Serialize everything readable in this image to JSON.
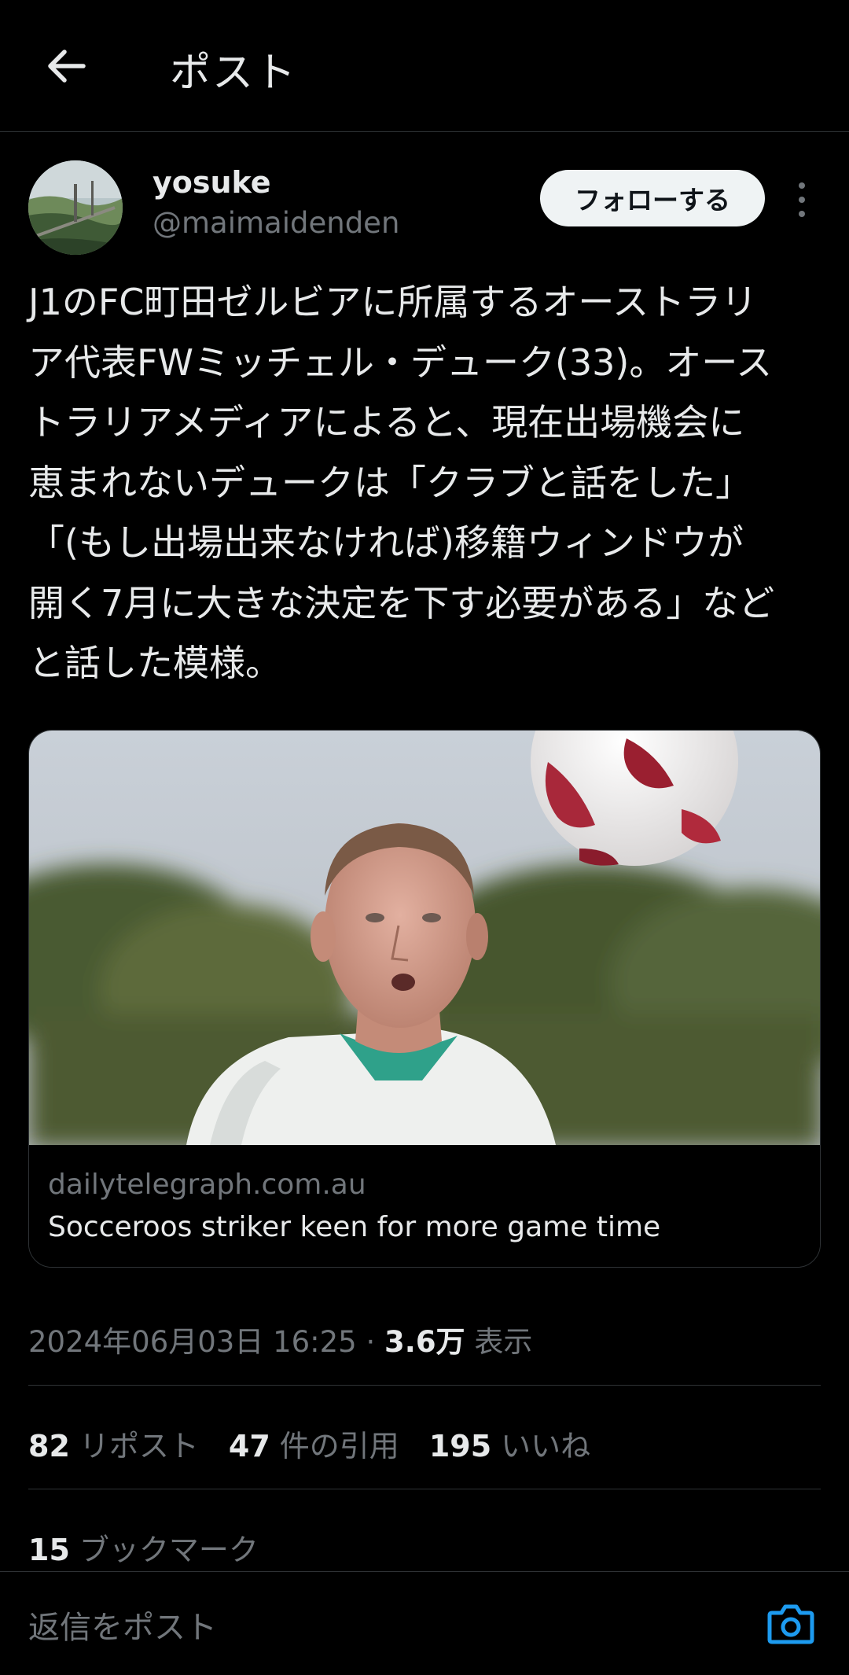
{
  "header": {
    "title": "ポスト"
  },
  "author": {
    "name": "yosuke",
    "handle": "@maimaidenden"
  },
  "actions": {
    "follow_label": "フォローする"
  },
  "post": {
    "text": "J1のFC町田ゼルビアに所属するオーストラリ\nア代表FWミッチェル・デューク(33)。オース\nトラリアメディアによると、現在出場機会に\n恵まれないデュークは「クラブと話をした」\n「(もし出場出来なければ)移籍ウィンドウが\n開く7月に大きな決定を下す必要がある」など\nと話した模様。"
  },
  "link_card": {
    "domain": "dailytelegraph.com.au",
    "title": "Socceroos striker keen for more game time"
  },
  "meta": {
    "date": "2024年06月03日 16:25",
    "separator": " · ",
    "views_count": "3.6万",
    "views_label": " 表示"
  },
  "stats": {
    "reposts_count": "82",
    "reposts_label": "リポスト",
    "quotes_count": "47",
    "quotes_label": "件の引用",
    "likes_count": "195",
    "likes_label": "いいね",
    "bookmarks_count": "15",
    "bookmarks_label": "ブックマーク"
  },
  "reply": {
    "placeholder": "返信をポスト"
  },
  "colors": {
    "background": "#000000",
    "text": "#e7e9ea",
    "secondary": "#71767b",
    "divider": "#2f3336",
    "accent": "#1d9bf0"
  }
}
